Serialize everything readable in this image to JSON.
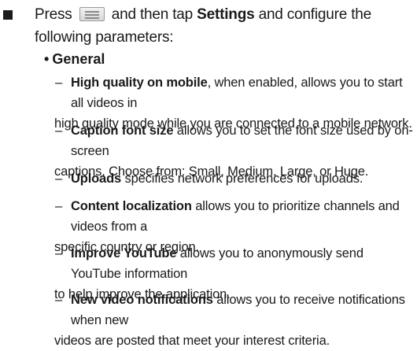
{
  "intro": {
    "press": "Press",
    "menu_icon": "menu-key-icon",
    "middle": "and then tap",
    "settings": "Settings",
    "rest": "and configure the following parameters:"
  },
  "section": {
    "bullet": "•",
    "title": "General"
  },
  "items": [
    {
      "dash": "–",
      "term": "High quality on mobile",
      "line1_rest": ", when enabled, allows you to start all videos in",
      "line2": "high quality mode while you are connected to a mobile network."
    },
    {
      "dash": "–",
      "term": "Caption font size",
      "line1_rest": " allows you to set the font size used by on-screen",
      "line2": "captions. Choose from: Small, Medium, Large, or Huge."
    },
    {
      "dash": "–",
      "term": "Uploads",
      "line1_rest": " specifies network preferences for uploads.",
      "line2": ""
    },
    {
      "dash": "–",
      "term": "Content localization",
      "line1_rest": " allows you to prioritize channels and videos from a",
      "line2": "specific country or region."
    },
    {
      "dash": "–",
      "term": "Improve YouTube",
      "line1_rest": " allows you to anonymously send YouTube information",
      "line2": "to help improve the application."
    },
    {
      "dash": "–",
      "term": "New video notifications",
      "line1_rest": " allows you to receive notifications when new",
      "line2": "videos are posted that meet your interest criteria."
    }
  ]
}
